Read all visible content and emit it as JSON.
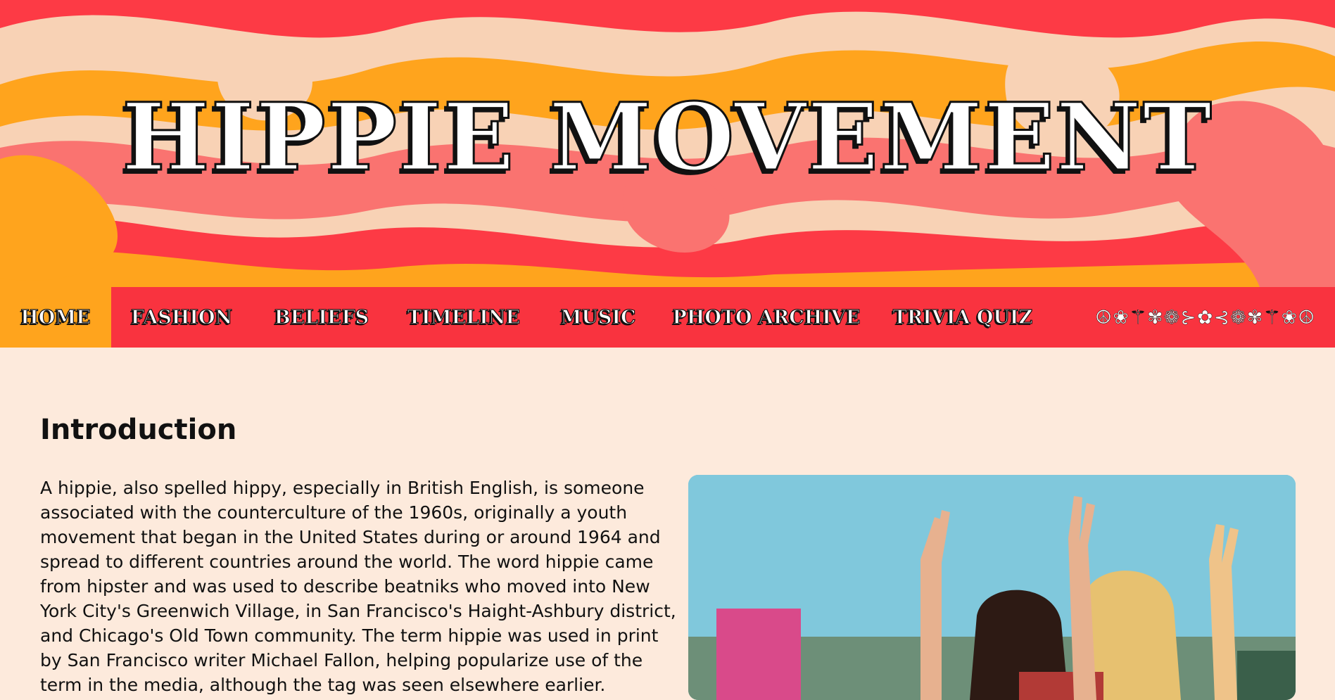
{
  "header": {
    "title": "HIPPIE MOVEMENT"
  },
  "nav": {
    "items": [
      {
        "label": "HOME",
        "active": true
      },
      {
        "label": "FASHION",
        "active": false
      },
      {
        "label": "BELIEFS",
        "active": false
      },
      {
        "label": "TIMELINE",
        "active": false
      },
      {
        "label": "MUSIC",
        "active": false
      },
      {
        "label": "PHOTO ARCHIVE",
        "active": false
      },
      {
        "label": "TRIVIA QUIZ",
        "active": false
      }
    ],
    "symbols": "☮❀⚚✾❁⊱✿⊰❁✾⚚❀☮"
  },
  "main": {
    "heading": "Introduction",
    "paragraph": "A hippie, also spelled hippy, especially in British English, is someone associated with the counterculture of the 1960s, originally a youth movement that began in the United States during or around 1964 and spread to different countries around the world. The word hippie came from hipster and was used to describe beatniks who moved into New York City's Greenwich Village, in San Francisco's Haight-Ashbury district, and Chicago's Old Town community. The term hippie was used in print by San Francisco writer Michael Fallon, helping popularize use of the term in the media, although the tag was seen elsewhere earlier."
  },
  "colors": {
    "nav_bg": "#f9333f",
    "nav_active": "#ffa41d",
    "page_bg": "#fdeadc",
    "swirl_orange": "#ffa41d",
    "swirl_red": "#fd3a45",
    "swirl_pink": "#fa7370",
    "swirl_cream": "#f8d2b5"
  }
}
